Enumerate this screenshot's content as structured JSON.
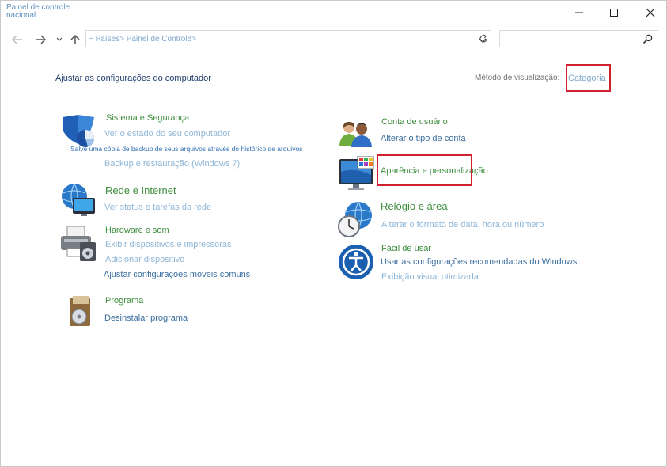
{
  "window": {
    "title": "Painel de controle nacional"
  },
  "nav": {
    "back_icon": "arrow-left-icon",
    "forward_icon": "arrow-right-icon",
    "recent_icon": "chevron-down-icon",
    "up_icon": "arrow-up-icon",
    "address": "~ Países> Painel de Controle>",
    "search_placeholder": ""
  },
  "header": {
    "heading": "Ajustar as configurações do computador",
    "view_by_label": "Método de visualização:",
    "view_by_value": "Categoria"
  },
  "categories": {
    "system": {
      "title": "Sistema e Segurança",
      "links": [
        "Ver o estado do seu computador",
        "Salve uma cópia de backup de seus arquivos através do histórico de arquivos",
        "Backup e restauração (Windows 7)"
      ]
    },
    "network": {
      "title": "Rede e Internet",
      "links": [
        "Ver status e tarefas da rede"
      ]
    },
    "hardware": {
      "title": "Hardware e som",
      "links": [
        "Exibir dispositivos e impressoras",
        "Adicionar dispositivo",
        "Ajustar configurações móveis comuns"
      ]
    },
    "programs": {
      "title": "Programa",
      "links": [
        "Desinstalar programa"
      ]
    },
    "user": {
      "title": "Conta de usuário",
      "links": [
        "Alterar o tipo de conta"
      ]
    },
    "appearance": {
      "title": "Aparência e personalização"
    },
    "clock": {
      "title": "Relógio e área",
      "links": [
        "Alterar o formato de data, hora ou número"
      ]
    },
    "ease": {
      "title": "Fácil de usar",
      "links": [
        "Usar as configurações recomendadas do Windows",
        "Exibição visual otimizada"
      ]
    }
  },
  "colors": {
    "highlight_box": "#d0202e",
    "category_title": "#3e8e3e",
    "link": "#3b6ea0"
  }
}
